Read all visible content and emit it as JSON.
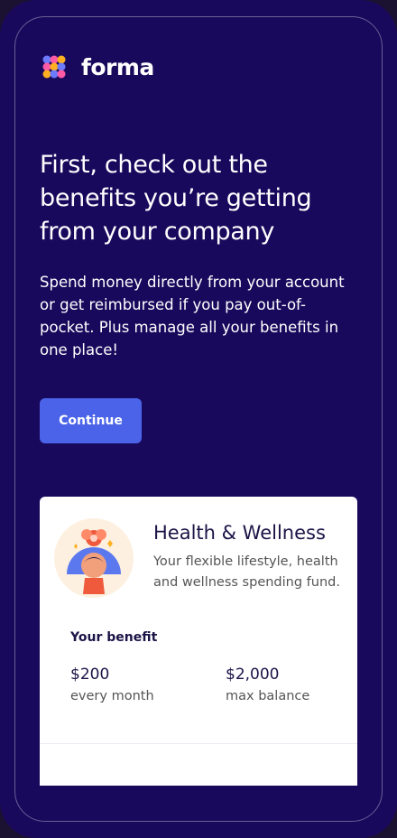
{
  "brand": {
    "name": "forma"
  },
  "hero": {
    "headline": "First, check out the benefits you’re getting from your company",
    "subtext": "Spend money directly from your account or get reimbursed if you pay out-of-pocket. Plus manage all your benefits in one place!",
    "cta_label": "Continue"
  },
  "benefit_card": {
    "title": "Health & Wellness",
    "description": "Your flexible lifestyle, health and wellness spending fund.",
    "section_label": "Your benefit",
    "stats": [
      {
        "value": "$200",
        "caption": "every month"
      },
      {
        "value": "$2,000",
        "caption": "max balance"
      }
    ]
  },
  "colors": {
    "background": "#19095c",
    "button": "#4a63e8",
    "card": "#ffffff",
    "text_dark": "#1b1447"
  },
  "icons": {
    "logo": "forma-logo-icon",
    "illustration": "wellness-person-illustration"
  }
}
